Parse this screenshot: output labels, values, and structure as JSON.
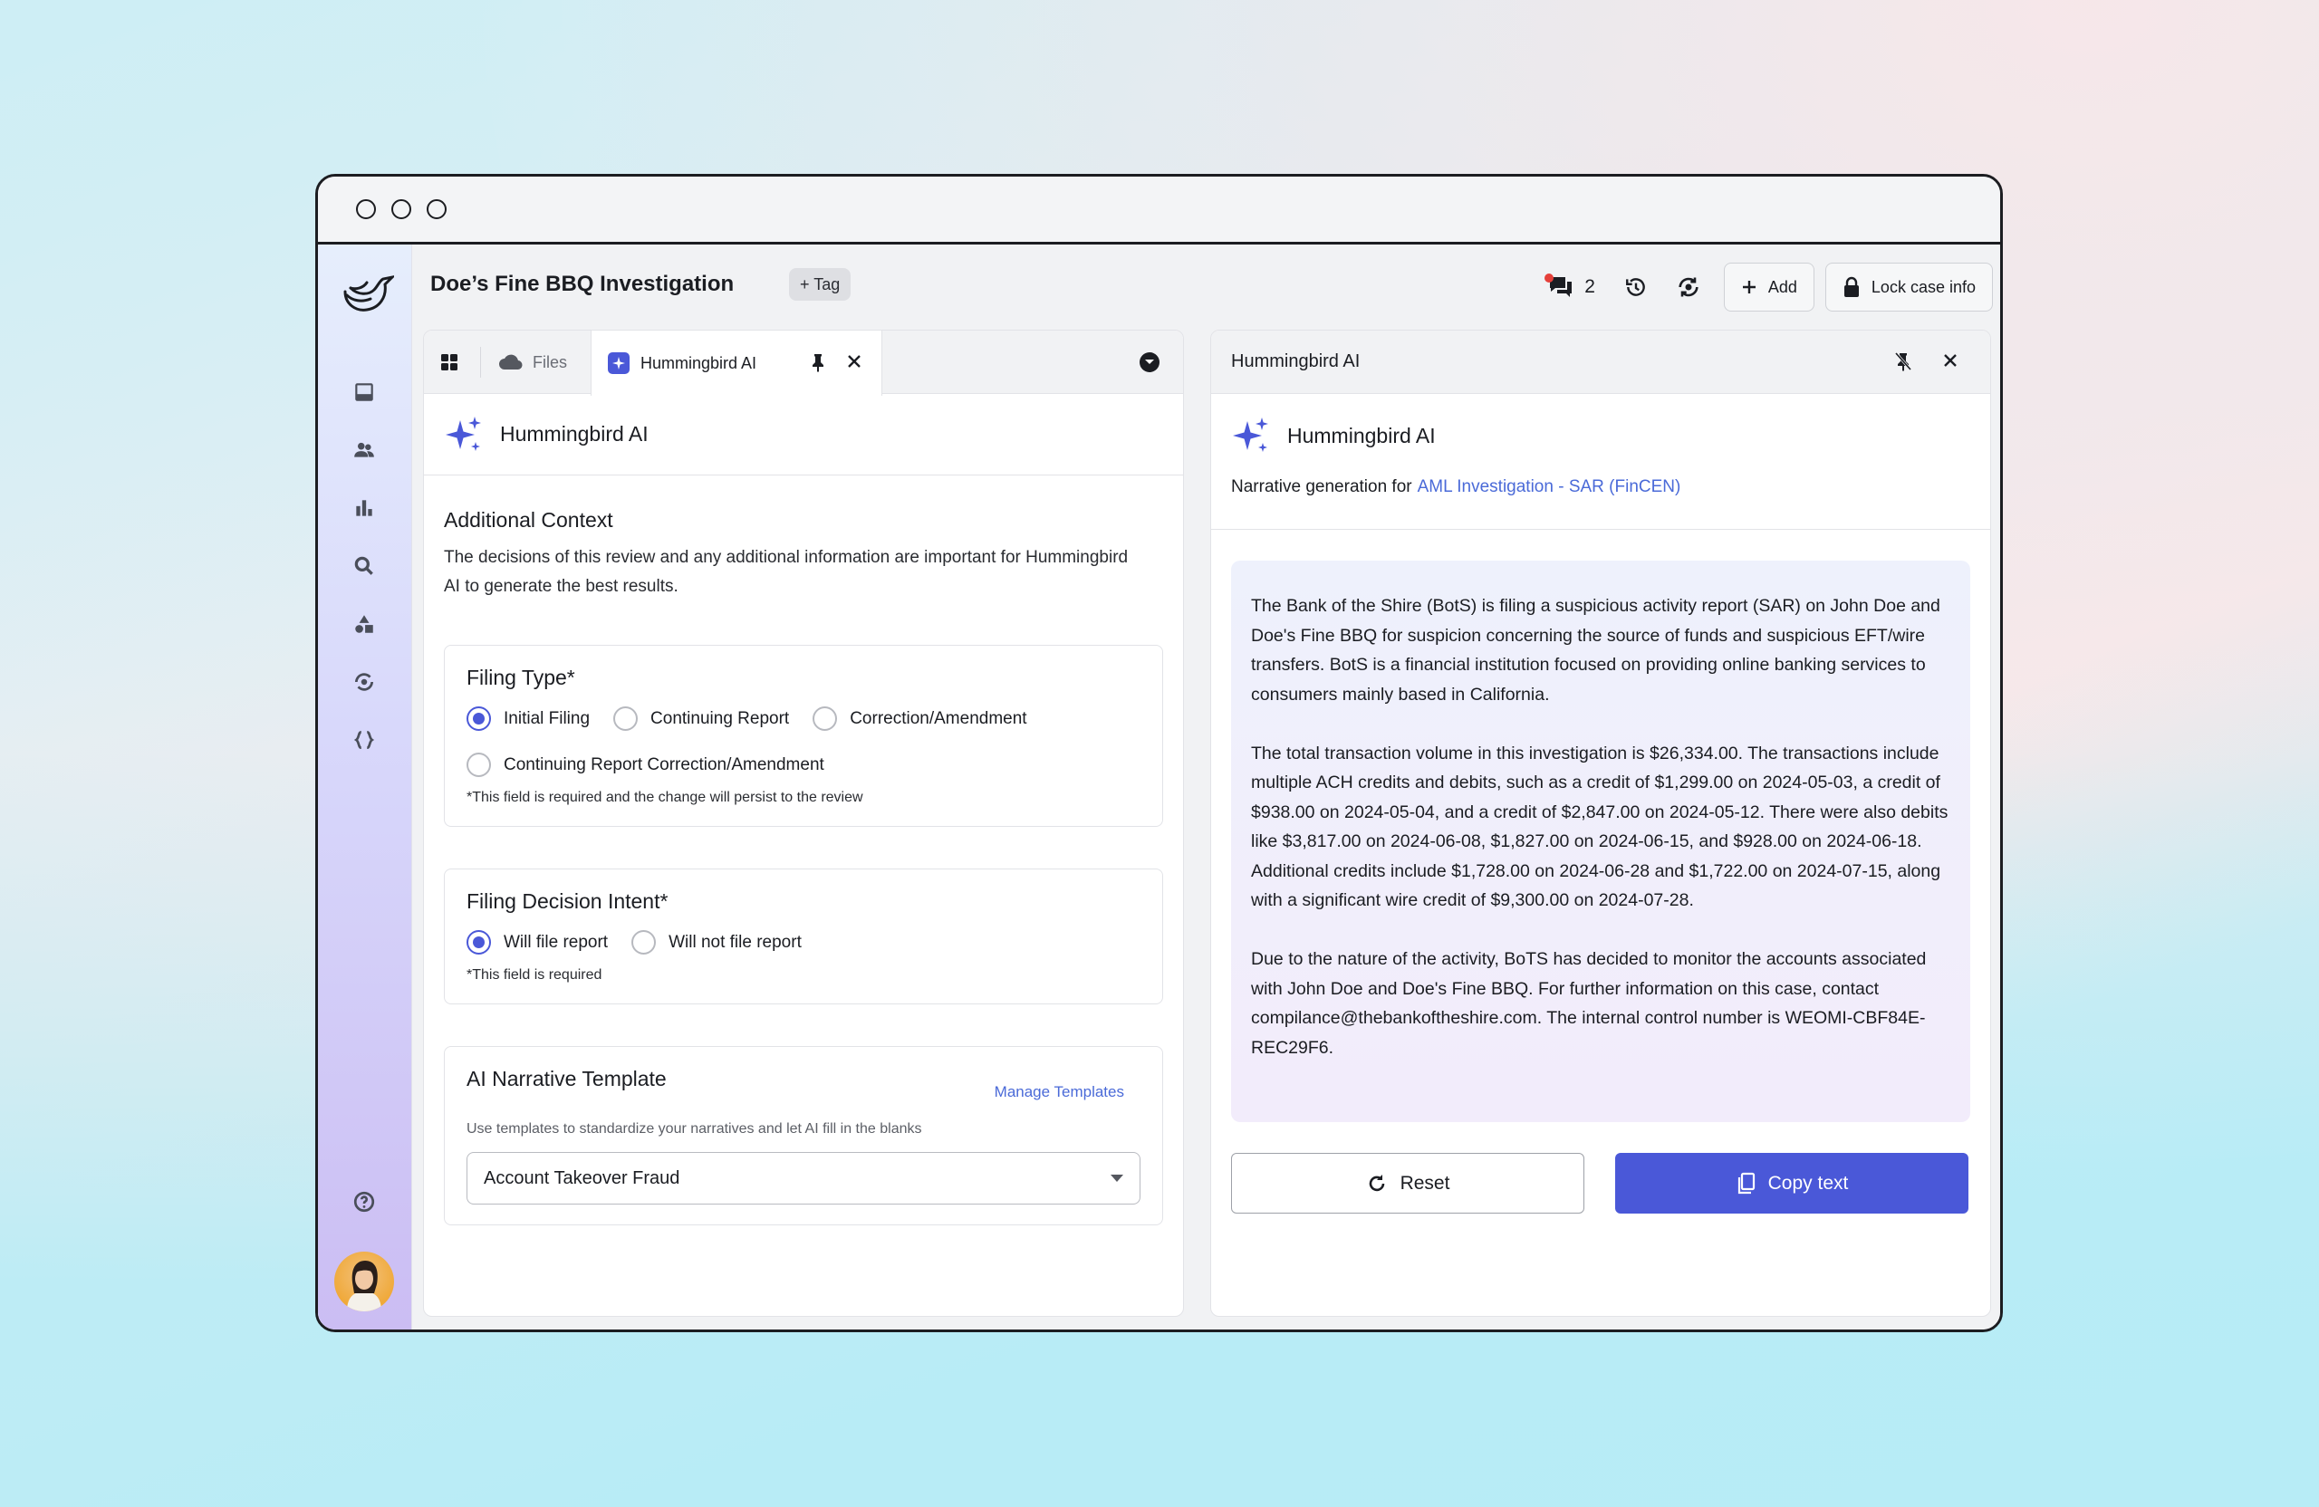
{
  "colors": {
    "accent": "#4a58d8",
    "link": "#4a6ad8",
    "notification_dot": "#e5403a"
  },
  "header": {
    "case_title": "Doe’s Fine BBQ Investigation",
    "tag_button": "+ Tag",
    "comment_count": "2",
    "add_button": "Add",
    "lock_button": "Lock case info"
  },
  "rail": {
    "icons": [
      "inbox-icon",
      "users-icon",
      "chart-icon",
      "search-icon",
      "shapes-icon",
      "sync-icon",
      "code-braces-icon",
      "help-icon",
      "bell-icon"
    ]
  },
  "left_panel": {
    "tabs": {
      "files": "Files",
      "active": "Hummingbird AI"
    },
    "ai_title": "Hummingbird AI",
    "context_title": "Additional Context",
    "context_desc": "The decisions of this review and any additional information are important for Hummingbird AI to generate the best results.",
    "filing_type": {
      "title": "Filing Type*",
      "options": [
        "Initial Filing",
        "Continuing Report",
        "Correction/Amendment",
        "Continuing Report Correction/Amendment"
      ],
      "selected": "Initial Filing",
      "note": "*This field is required and the change will persist to the review"
    },
    "filing_decision": {
      "title": "Filing Decision Intent*",
      "options": [
        "Will file report",
        "Will not file report"
      ],
      "selected": "Will file report",
      "note": "*This field is required"
    },
    "template": {
      "title": "AI Narrative Template",
      "manage_link": "Manage Templates",
      "desc": "Use templates to standardize your narratives and let AI fill in the blanks",
      "selected": "Account Takeover Fraud"
    }
  },
  "right_panel": {
    "top_title": "Hummingbird AI",
    "ai_title": "Hummingbird AI",
    "sub_prefix": "Narrative generation for",
    "sub_link": "AML Investigation - SAR (FinCEN)",
    "narrative": [
      "The Bank of the Shire (BotS) is filing a suspicious activity report (SAR) on John Doe and Doe's Fine BBQ for suspicion concerning the source of funds and suspicious EFT/wire transfers. BotS is a financial institution focused on providing online banking services to consumers mainly based in California.",
      "The total transaction volume in this investigation is $26,334.00. The transactions include multiple ACH credits and debits, such as a credit of $1,299.00 on 2024-05-03, a credit of $938.00 on 2024-05-04, and a credit of $2,847.00 on 2024-05-12. There were also debits like $3,817.00 on 2024-06-08, $1,827.00 on 2024-06-15, and $928.00 on 2024-06-18. Additional credits include $1,728.00 on 2024-06-28 and $1,722.00 on 2024-07-15, along with a significant wire credit of $9,300.00 on 2024-07-28.",
      "Due to the nature of the activity, BoTS has decided to monitor the accounts associated with John Doe and Doe's Fine BBQ. For further information on this case, contact compilance@thebankoftheshire.com. The internal control number is WEOMI-CBF84E-REC29F6."
    ],
    "reset_button": "Reset",
    "copy_button": "Copy text"
  }
}
